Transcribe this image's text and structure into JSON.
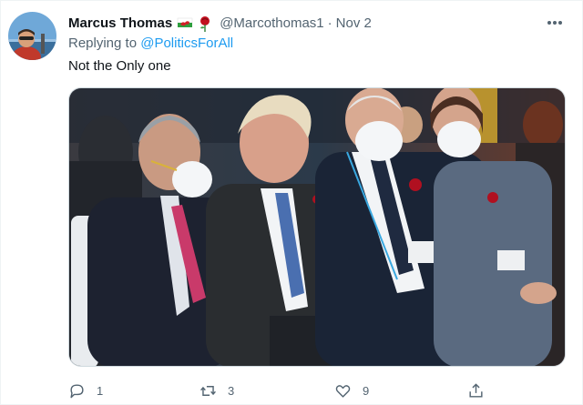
{
  "tweet": {
    "author_name": "Marcus Thomas",
    "author_handle": "@Marcothomas1",
    "separator": "·",
    "date": "Nov 2",
    "replying_prefix": "Replying to",
    "replying_to": "@PoliticsForAll",
    "text": "Not the Only one",
    "badges": [
      "wales-flag-icon",
      "rose-icon"
    ]
  },
  "actions": {
    "reply_count": "1",
    "retweet_count": "3",
    "like_count": "9"
  },
  "colors": {
    "accent": "#1d9bf0",
    "secondary_text": "#536471",
    "primary_text": "#0f1419",
    "border": "#cfd9de"
  }
}
